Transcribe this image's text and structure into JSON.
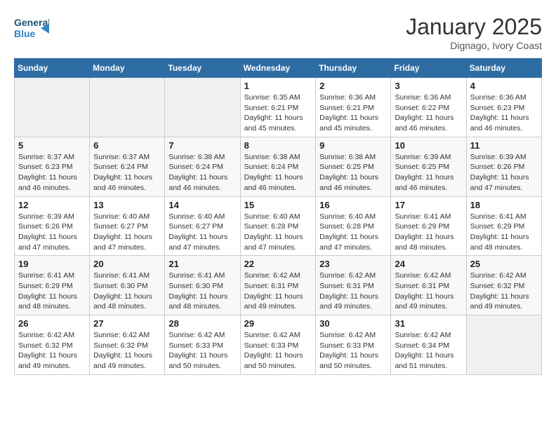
{
  "header": {
    "logo_line1": "General",
    "logo_line2": "Blue",
    "month_title": "January 2025",
    "location": "Dignago, Ivory Coast"
  },
  "days_of_week": [
    "Sunday",
    "Monday",
    "Tuesday",
    "Wednesday",
    "Thursday",
    "Friday",
    "Saturday"
  ],
  "weeks": [
    [
      {
        "day": "",
        "info": ""
      },
      {
        "day": "",
        "info": ""
      },
      {
        "day": "",
        "info": ""
      },
      {
        "day": "1",
        "info": "Sunrise: 6:35 AM\nSunset: 6:21 PM\nDaylight: 11 hours and 45 minutes."
      },
      {
        "day": "2",
        "info": "Sunrise: 6:36 AM\nSunset: 6:21 PM\nDaylight: 11 hours and 45 minutes."
      },
      {
        "day": "3",
        "info": "Sunrise: 6:36 AM\nSunset: 6:22 PM\nDaylight: 11 hours and 46 minutes."
      },
      {
        "day": "4",
        "info": "Sunrise: 6:36 AM\nSunset: 6:23 PM\nDaylight: 11 hours and 46 minutes."
      }
    ],
    [
      {
        "day": "5",
        "info": "Sunrise: 6:37 AM\nSunset: 6:23 PM\nDaylight: 11 hours and 46 minutes."
      },
      {
        "day": "6",
        "info": "Sunrise: 6:37 AM\nSunset: 6:24 PM\nDaylight: 11 hours and 46 minutes."
      },
      {
        "day": "7",
        "info": "Sunrise: 6:38 AM\nSunset: 6:24 PM\nDaylight: 11 hours and 46 minutes."
      },
      {
        "day": "8",
        "info": "Sunrise: 6:38 AM\nSunset: 6:24 PM\nDaylight: 11 hours and 46 minutes."
      },
      {
        "day": "9",
        "info": "Sunrise: 6:38 AM\nSunset: 6:25 PM\nDaylight: 11 hours and 46 minutes."
      },
      {
        "day": "10",
        "info": "Sunrise: 6:39 AM\nSunset: 6:25 PM\nDaylight: 11 hours and 46 minutes."
      },
      {
        "day": "11",
        "info": "Sunrise: 6:39 AM\nSunset: 6:26 PM\nDaylight: 11 hours and 47 minutes."
      }
    ],
    [
      {
        "day": "12",
        "info": "Sunrise: 6:39 AM\nSunset: 6:26 PM\nDaylight: 11 hours and 47 minutes."
      },
      {
        "day": "13",
        "info": "Sunrise: 6:40 AM\nSunset: 6:27 PM\nDaylight: 11 hours and 47 minutes."
      },
      {
        "day": "14",
        "info": "Sunrise: 6:40 AM\nSunset: 6:27 PM\nDaylight: 11 hours and 47 minutes."
      },
      {
        "day": "15",
        "info": "Sunrise: 6:40 AM\nSunset: 6:28 PM\nDaylight: 11 hours and 47 minutes."
      },
      {
        "day": "16",
        "info": "Sunrise: 6:40 AM\nSunset: 6:28 PM\nDaylight: 11 hours and 47 minutes."
      },
      {
        "day": "17",
        "info": "Sunrise: 6:41 AM\nSunset: 6:29 PM\nDaylight: 11 hours and 48 minutes."
      },
      {
        "day": "18",
        "info": "Sunrise: 6:41 AM\nSunset: 6:29 PM\nDaylight: 11 hours and 48 minutes."
      }
    ],
    [
      {
        "day": "19",
        "info": "Sunrise: 6:41 AM\nSunset: 6:29 PM\nDaylight: 11 hours and 48 minutes."
      },
      {
        "day": "20",
        "info": "Sunrise: 6:41 AM\nSunset: 6:30 PM\nDaylight: 11 hours and 48 minutes."
      },
      {
        "day": "21",
        "info": "Sunrise: 6:41 AM\nSunset: 6:30 PM\nDaylight: 11 hours and 48 minutes."
      },
      {
        "day": "22",
        "info": "Sunrise: 6:42 AM\nSunset: 6:31 PM\nDaylight: 11 hours and 49 minutes."
      },
      {
        "day": "23",
        "info": "Sunrise: 6:42 AM\nSunset: 6:31 PM\nDaylight: 11 hours and 49 minutes."
      },
      {
        "day": "24",
        "info": "Sunrise: 6:42 AM\nSunset: 6:31 PM\nDaylight: 11 hours and 49 minutes."
      },
      {
        "day": "25",
        "info": "Sunrise: 6:42 AM\nSunset: 6:32 PM\nDaylight: 11 hours and 49 minutes."
      }
    ],
    [
      {
        "day": "26",
        "info": "Sunrise: 6:42 AM\nSunset: 6:32 PM\nDaylight: 11 hours and 49 minutes."
      },
      {
        "day": "27",
        "info": "Sunrise: 6:42 AM\nSunset: 6:32 PM\nDaylight: 11 hours and 49 minutes."
      },
      {
        "day": "28",
        "info": "Sunrise: 6:42 AM\nSunset: 6:33 PM\nDaylight: 11 hours and 50 minutes."
      },
      {
        "day": "29",
        "info": "Sunrise: 6:42 AM\nSunset: 6:33 PM\nDaylight: 11 hours and 50 minutes."
      },
      {
        "day": "30",
        "info": "Sunrise: 6:42 AM\nSunset: 6:33 PM\nDaylight: 11 hours and 50 minutes."
      },
      {
        "day": "31",
        "info": "Sunrise: 6:42 AM\nSunset: 6:34 PM\nDaylight: 11 hours and 51 minutes."
      },
      {
        "day": "",
        "info": ""
      }
    ]
  ]
}
